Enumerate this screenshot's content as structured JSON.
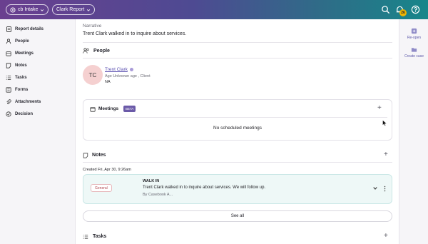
{
  "topbar": {
    "intake_label": "cb Intake",
    "report_label": "Clark Report",
    "notification_count": "26"
  },
  "sidebar": {
    "items": [
      {
        "label": "Report details"
      },
      {
        "label": "People"
      },
      {
        "label": "Meetings"
      },
      {
        "label": "Notes"
      },
      {
        "label": "Tasks"
      },
      {
        "label": "Forms"
      },
      {
        "label": "Attachments"
      },
      {
        "label": "Decision"
      }
    ]
  },
  "rightbar": {
    "reopen_label": "Re-open",
    "create_case_label": "Create case"
  },
  "narrative": {
    "label": "Narrative",
    "text": "Trent Clark walked in to inquire about services."
  },
  "people": {
    "title": "People",
    "initials": "TC",
    "name": "Trent Clark",
    "details": "Age Unknown age , Client",
    "extra": "NA"
  },
  "meetings": {
    "title": "Meetings",
    "badge": "BETA",
    "empty_text": "No scheduled meetings"
  },
  "notes": {
    "title": "Notes",
    "created": "Created Fri, Apr 30, 9:26am",
    "chip": "General",
    "note_title": "WALK IN",
    "note_body": "Trent Clark walked in to inquire about services. We will follow up.",
    "note_author": "By Casebook A...",
    "see_all": "See all"
  },
  "tasks": {
    "title": "Tasks"
  }
}
